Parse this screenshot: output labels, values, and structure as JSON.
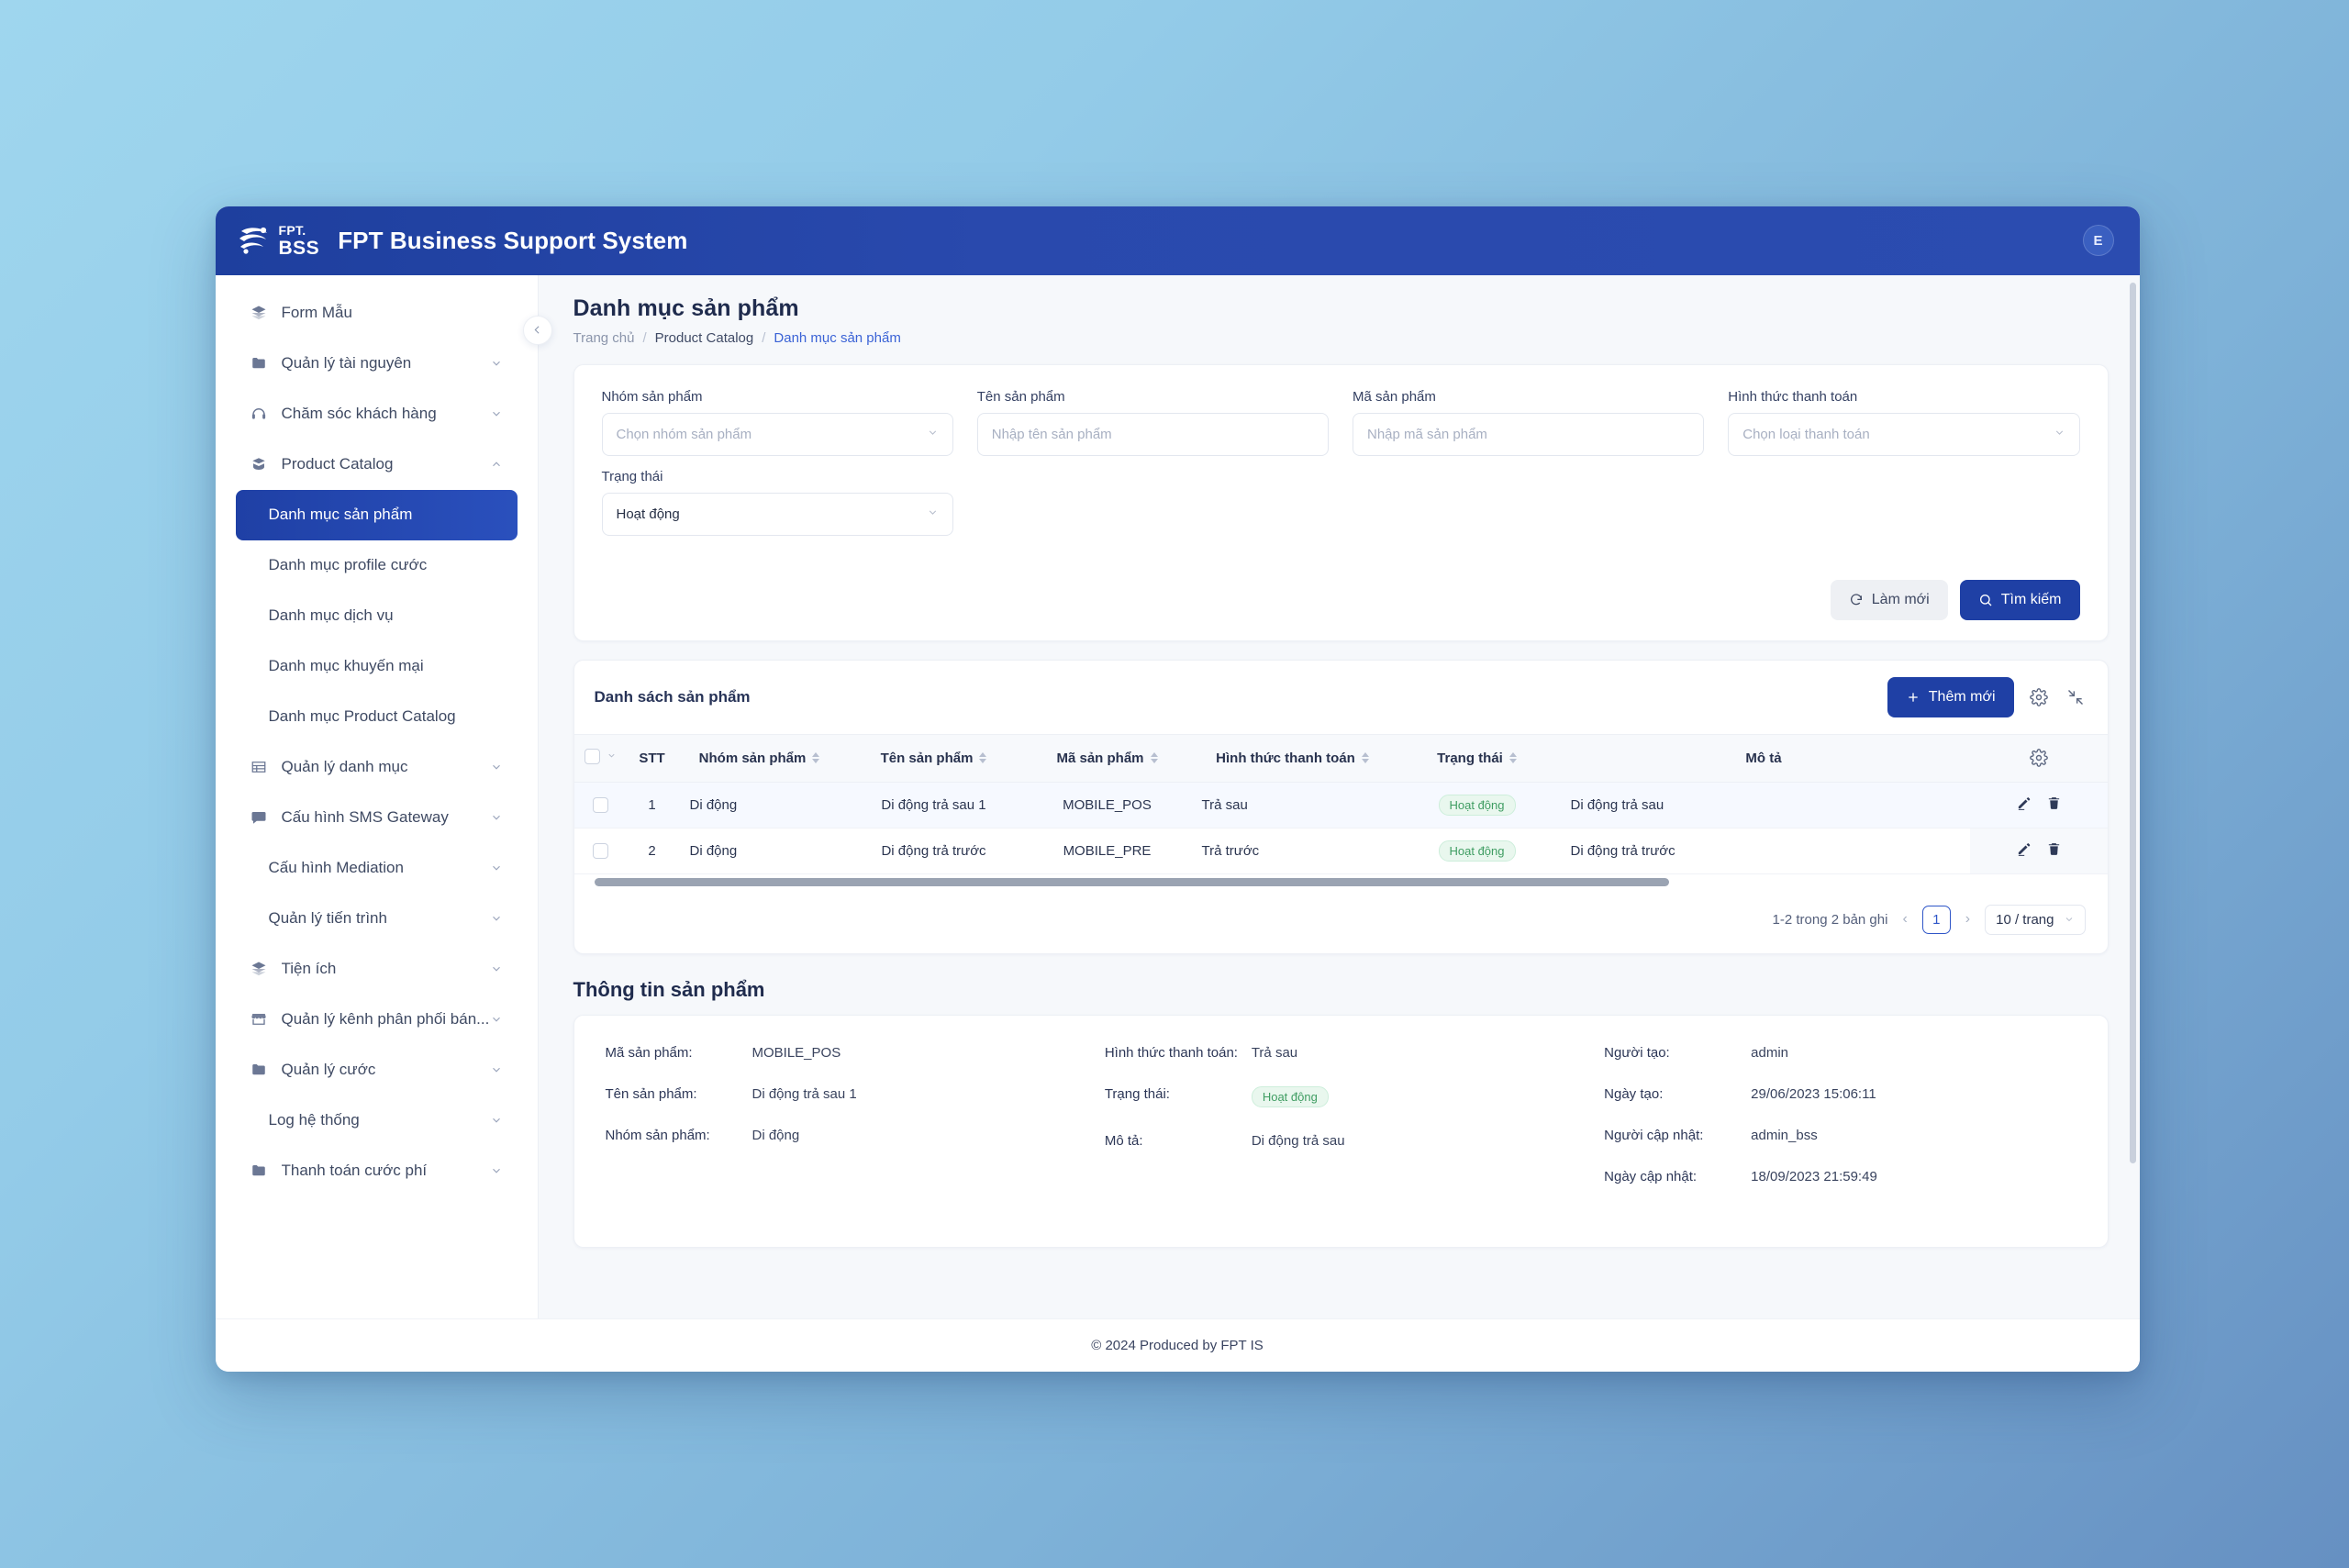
{
  "topbar": {
    "logo_fpt": "FPT.",
    "logo_bss": "BSS",
    "app_title": "FPT Business Support System",
    "avatar_initial": "E"
  },
  "sidebar": {
    "items": [
      {
        "label": "Form Mẫu",
        "icon": "layers-icon",
        "level": "top",
        "chevron": false,
        "active": false
      },
      {
        "label": "Quản lý tài nguyên",
        "icon": "folder-icon",
        "level": "top",
        "chevron": true,
        "active": false
      },
      {
        "label": "Chăm sóc khách hàng",
        "icon": "headset-icon",
        "level": "top",
        "chevron": true,
        "active": false
      },
      {
        "label": "Product Catalog",
        "icon": "catalog-icon",
        "level": "top",
        "chevron": true,
        "expanded": true,
        "active": false
      },
      {
        "label": "Danh mục sản phẩm",
        "icon": "",
        "level": "sub",
        "chevron": false,
        "active": true
      },
      {
        "label": "Danh mục profile cước",
        "icon": "",
        "level": "sub",
        "chevron": false,
        "active": false
      },
      {
        "label": "Danh mục dịch vụ",
        "icon": "",
        "level": "sub",
        "chevron": false,
        "active": false
      },
      {
        "label": "Danh mục khuyến mại",
        "icon": "",
        "level": "sub",
        "chevron": false,
        "active": false
      },
      {
        "label": "Danh mục Product Catalog",
        "icon": "",
        "level": "sub",
        "chevron": false,
        "active": false
      },
      {
        "label": "Quản lý danh mục",
        "icon": "table-icon",
        "level": "top",
        "chevron": true,
        "active": false
      },
      {
        "label": "Cấu hình SMS Gateway",
        "icon": "chat-icon",
        "level": "top",
        "chevron": true,
        "active": false
      },
      {
        "label": "Cấu hình Mediation",
        "icon": "",
        "level": "sub",
        "chevron": true,
        "active": false
      },
      {
        "label": "Quản lý tiến trình",
        "icon": "",
        "level": "sub",
        "chevron": true,
        "active": false
      },
      {
        "label": "Tiện ích",
        "icon": "layers-icon",
        "level": "top",
        "chevron": true,
        "active": false
      },
      {
        "label": "Quản lý kênh phân phối bán...",
        "icon": "store-icon",
        "level": "top",
        "chevron": true,
        "active": false
      },
      {
        "label": "Quản lý cước",
        "icon": "folder-icon",
        "level": "top",
        "chevron": true,
        "active": false
      },
      {
        "label": "Log hệ thống",
        "icon": "",
        "level": "sub",
        "chevron": true,
        "active": false
      },
      {
        "label": "Thanh toán cước phí",
        "icon": "folder-icon",
        "level": "top",
        "chevron": true,
        "active": false
      }
    ],
    "collapse_icon": "chevron-left-icon"
  },
  "page": {
    "title": "Danh mục sản phẩm",
    "breadcrumb": [
      "Trang chủ",
      "Product Catalog",
      "Danh mục sản phẩm"
    ]
  },
  "filters": {
    "fields": [
      {
        "label": "Nhóm sản phẩm",
        "placeholder": "Chọn nhóm sản phẩm",
        "value": "",
        "type": "select"
      },
      {
        "label": "Tên sản phẩm",
        "placeholder": "Nhập tên sản phẩm",
        "value": "",
        "type": "input"
      },
      {
        "label": "Mã sản phẩm",
        "placeholder": "Nhập mã sản phẩm",
        "value": "",
        "type": "input"
      },
      {
        "label": "Hình thức thanh toán",
        "placeholder": "Chọn loại thanh toán",
        "value": "",
        "type": "select"
      },
      {
        "label": "Trạng thái",
        "placeholder": "",
        "value": "Hoạt động",
        "type": "select"
      }
    ],
    "refresh_label": "Làm mới",
    "search_label": "Tìm kiếm"
  },
  "list": {
    "title": "Danh sách sản phẩm",
    "add_label": "Thêm mới",
    "settings_icon": "gear-icon",
    "expand_icon": "compress-icon",
    "columns": [
      "STT",
      "Nhóm sản phẩm",
      "Tên sản phẩm",
      "Mã sản phẩm",
      "Hình thức thanh toán",
      "Trạng thái",
      "Mô tả"
    ],
    "rows": [
      {
        "stt": "1",
        "group": "Di động",
        "name": "Di động trả sau 1",
        "code": "MOBILE_POS",
        "payment": "Trả sau",
        "status": "Hoạt động",
        "description": "Di động trả sau"
      },
      {
        "stt": "2",
        "group": "Di động",
        "name": "Di động trả trước",
        "code": "MOBILE_PRE",
        "payment": "Trả trước",
        "status": "Hoạt động",
        "description": "Di động trả trước"
      }
    ],
    "pagination": {
      "summary": "1-2 trong 2 bản ghi",
      "prev": "‹",
      "page": "1",
      "next": "›",
      "page_size": "10 / trang"
    }
  },
  "detail": {
    "title": "Thông tin sản phẩm",
    "col1": [
      {
        "label": "Mã sản phẩm:",
        "value": "MOBILE_POS"
      },
      {
        "label": "Tên sản phẩm:",
        "value": "Di động trả sau 1"
      },
      {
        "label": "Nhóm sản phẩm:",
        "value": "Di động"
      }
    ],
    "col2": [
      {
        "label": "Hình thức thanh toán:",
        "value": "Trả sau"
      },
      {
        "label": "Trạng thái:",
        "value": "Hoạt động",
        "badge": true
      },
      {
        "label": "Mô tả:",
        "value": "Di động trả sau"
      }
    ],
    "col3": [
      {
        "label": "Người tạo:",
        "value": "admin"
      },
      {
        "label": "Ngày tạo:",
        "value": "29/06/2023 15:06:11"
      },
      {
        "label": "Người cập nhật:",
        "value": "admin_bss"
      },
      {
        "label": "Ngày cập nhật:",
        "value": "18/09/2023 21:59:49"
      }
    ]
  },
  "footer": {
    "text": "© 2024 Produced by FPT IS"
  },
  "colors": {
    "brand_blue": "#1f40a5",
    "accent_link": "#3b63d6",
    "status_green_bg": "#e9f7ee",
    "status_green_text": "#3f9d62",
    "page_bg": "#f6f8fb"
  }
}
